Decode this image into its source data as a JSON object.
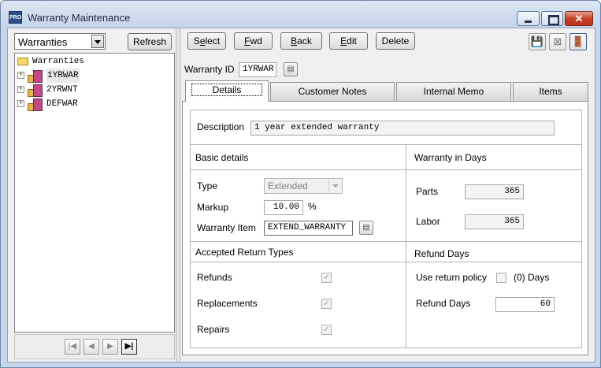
{
  "window": {
    "title": "Warranty Maintenance",
    "app_badge": "PRO",
    "close_glyph": "✕"
  },
  "left": {
    "combo_value": "Warranties",
    "refresh_label": "Refresh",
    "tree_root": "Warranties",
    "tree_items": [
      "1YRWAR",
      "2YRWNT",
      "DEFWAR"
    ],
    "nav": {
      "first": "|◀",
      "prev": "◀",
      "next": "▶",
      "last": "▶|"
    }
  },
  "toolbar": {
    "select": {
      "accel": "e",
      "pre": "S",
      "post": "lect"
    },
    "fwd": {
      "accel": "F",
      "pre": "",
      "post": "wd"
    },
    "back": {
      "accel": "B",
      "pre": "",
      "post": "ack"
    },
    "edit": {
      "accel": "E",
      "pre": "",
      "post": "dit"
    },
    "delete_label": "Delete",
    "icons": {
      "save": "💾",
      "cancel": "⊠",
      "exit": "🚪"
    }
  },
  "header": {
    "id_label": "Warranty ID",
    "id_value": "1YRWAR"
  },
  "tabs": [
    "Details",
    "Customer Notes",
    "Internal Memo",
    "Items"
  ],
  "details": {
    "description_label": "Description",
    "description_value": "1 year extended warranty",
    "basic_title": "Basic details",
    "type_label": "Type",
    "type_value": "Extended",
    "markup_label": "Markup",
    "markup_value": "10.00",
    "markup_unit": "%",
    "item_label": "Warranty Item",
    "item_value": "EXTEND_WARRANTY",
    "days_title": "Warranty in Days",
    "parts_label": "Parts",
    "parts_value": "365",
    "labor_label": "Labor",
    "labor_value": "365",
    "return_title": "Accepted Return Types",
    "refunds_label": "Refunds",
    "replacements_label": "Replacements",
    "repairs_label": "Repairs",
    "refund_title": "Refund Days",
    "use_policy_label": "Use return policy",
    "policy_days_text": "(0) Days",
    "refund_days_label": "Refund Days",
    "refund_days_value": "60",
    "check_glyph": "✓"
  }
}
